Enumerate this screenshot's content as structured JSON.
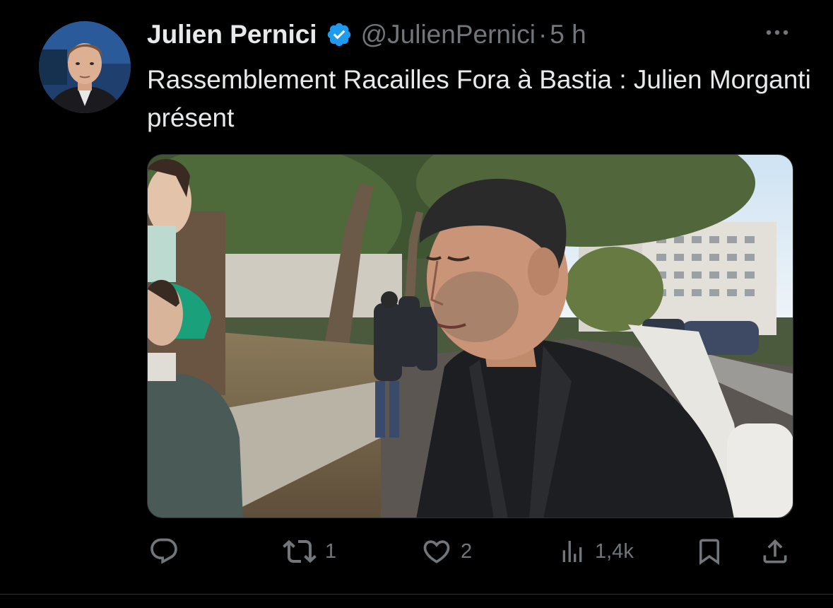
{
  "tweet": {
    "author": {
      "display_name": "Julien Pernici",
      "handle": "@JulienPernici",
      "verified": true
    },
    "separator": "·",
    "timestamp": "5 h",
    "text": "Rassemblement Racailles Fora à Bastia : Julien Morganti présent",
    "media": {
      "kind": "photo",
      "subject": "man in black jacket on street, people in background"
    }
  },
  "actions": {
    "reply": {
      "icon": "reply-icon"
    },
    "retweet": {
      "icon": "retweet-icon",
      "count": "1"
    },
    "like": {
      "icon": "heart-icon",
      "count": "2"
    },
    "views": {
      "icon": "analytics-icon",
      "count": "1,4k"
    },
    "bookmark": {
      "icon": "bookmark-icon"
    },
    "share": {
      "icon": "share-icon"
    }
  },
  "colors": {
    "background": "#000000",
    "primary_text": "#e7e9ea",
    "secondary_text": "#71767b",
    "verified_blue": "#1d9bf0",
    "divider": "#2f3336"
  }
}
